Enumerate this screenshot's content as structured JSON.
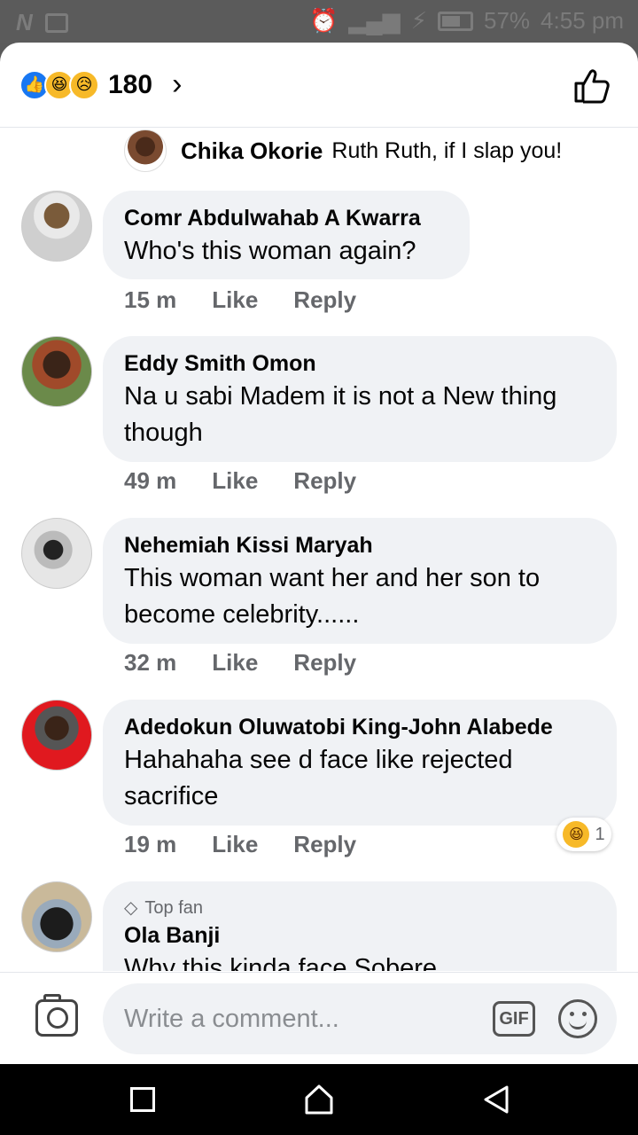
{
  "status_bar": {
    "battery": "57%",
    "time": "4:55 pm"
  },
  "header": {
    "reaction_count": "180",
    "reaction_icons": [
      "like-icon",
      "haha-icon",
      "sad-icon"
    ]
  },
  "reply_preview": {
    "author": "Chika Okorie",
    "text": "Ruth Ruth, if I slap you!"
  },
  "comments": [
    {
      "author": "Comr Abdulwahab A Kwarra",
      "text": "Who's this woman again?",
      "time": "15 m",
      "like": "Like",
      "reply": "Reply"
    },
    {
      "author": "Eddy Smith Omon",
      "text": "Na u sabi Madem it is not a New thing though",
      "time": "49 m",
      "like": "Like",
      "reply": "Reply"
    },
    {
      "author": "Nehemiah Kissi Maryah",
      "text": "This woman want her and her son to become celebrity......",
      "time": "32 m",
      "like": "Like",
      "reply": "Reply"
    },
    {
      "author": "Adedokun Oluwatobi King-John Alabede",
      "text": "Hahahaha see d face like rejected sacrifice",
      "time": "19 m",
      "like": "Like",
      "reply": "Reply",
      "reaction_count": "1"
    },
    {
      "badge": "Top fan",
      "author": "Ola Banji",
      "text": "Why this kinda face Sobere"
    }
  ],
  "composer": {
    "placeholder": "Write a comment...",
    "gif_label": "GIF"
  },
  "colors": {
    "bubble": "#f0f2f5",
    "like_blue": "#1877f2",
    "meta_gray": "#65676b"
  }
}
